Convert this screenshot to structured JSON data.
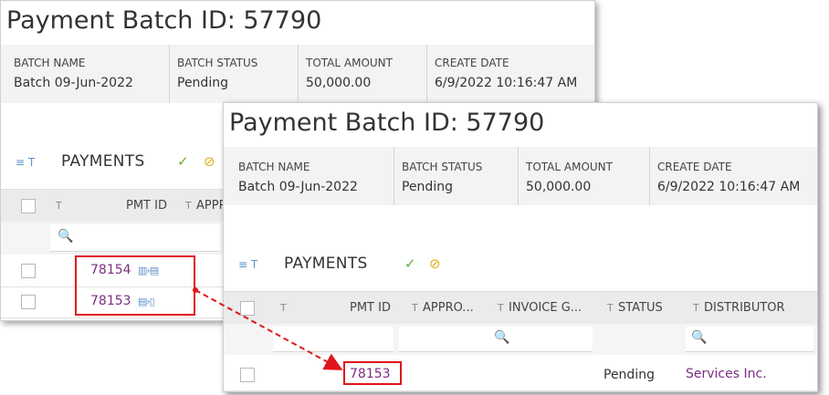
{
  "back": {
    "title": "Payment Batch ID: 57790",
    "fields": [
      {
        "label": "BATCH NAME",
        "value": "Batch 09-Jun-2022"
      },
      {
        "label": "BATCH STATUS",
        "value": "Pending"
      },
      {
        "label": "TOTAL AMOUNT",
        "value": "50,000.00"
      },
      {
        "label": "CREATE DATE",
        "value": "6/9/2022 10:16:47 AM"
      }
    ],
    "payments_label": "PAYMENTS",
    "columns": {
      "pmt_id": "PMT ID",
      "approved": "APPR"
    },
    "rows": [
      {
        "pmt_id": "78154"
      },
      {
        "pmt_id": "78153"
      }
    ]
  },
  "front": {
    "title": "Payment Batch ID: 57790",
    "fields": [
      {
        "label": "BATCH NAME",
        "value": "Batch 09-Jun-2022"
      },
      {
        "label": "BATCH STATUS",
        "value": "Pending"
      },
      {
        "label": "TOTAL AMOUNT",
        "value": "50,000.00"
      },
      {
        "label": "CREATE DATE",
        "value": "6/9/2022 10:16:47 AM"
      }
    ],
    "payments_label": "PAYMENTS",
    "columns": {
      "pmt_id": "PMT ID",
      "approved": "APPRO...",
      "invoice": "INVOICE G...",
      "status": "STATUS",
      "distributor": "DISTRIBUTOR"
    },
    "rows": [
      {
        "pmt_id": "78153",
        "status": "Pending",
        "distributor": "Services Inc."
      }
    ]
  },
  "icons": {
    "filter_toggle": "≡ T",
    "funnel": "T",
    "search": "🔍",
    "approve": "✓",
    "alert": "⊘",
    "control_a": "▥›▤",
    "control_b": "▤›▯"
  },
  "colors": {
    "link": "#7b2d83",
    "accent_blue": "#5b8fc9",
    "annotation_red": "#e0151b"
  }
}
